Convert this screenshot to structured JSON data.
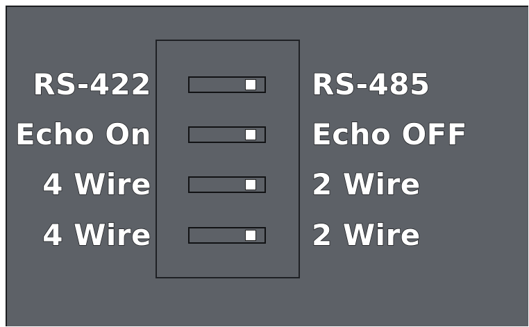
{
  "switches": [
    {
      "left_label": "RS-422",
      "right_label": "RS-485",
      "position": "right"
    },
    {
      "left_label": "Echo On",
      "right_label": "Echo OFF",
      "position": "right"
    },
    {
      "left_label": "4 Wire",
      "right_label": "2 Wire",
      "position": "right"
    },
    {
      "left_label": "4 Wire",
      "right_label": "2 Wire",
      "position": "right"
    }
  ],
  "colors": {
    "background": "#5d6167",
    "label": "#ffffff",
    "outline": "#1e2024",
    "knob": "#ffffff"
  }
}
